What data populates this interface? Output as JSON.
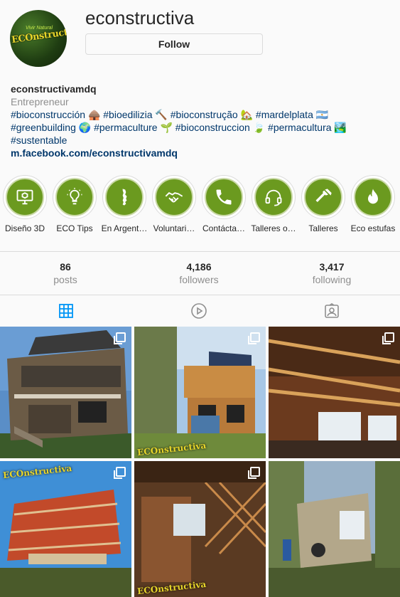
{
  "profile": {
    "username": "econstructiva",
    "follow_label": "Follow",
    "avatar_text_top": "Vivir Natural",
    "avatar_text": "ECOnstructiva",
    "display_name": "econstructivamdq",
    "category": "Entrepreneur",
    "bio_line1": "#bioconstrucción 🛖 #bioedilizia 🔨 #bioconstrução 🏡 #mardelplata 🇦🇷",
    "bio_line2": "#greenbuilding 🌍 #permaculture 🌱 #bioconstruccion 🍃 #permacultura 🏞️",
    "bio_line3": "#sustentable",
    "website": "m.facebook.com/econstructivamdq"
  },
  "highlights": [
    {
      "label": "Diseño 3D",
      "icon": "cube-monitor-icon"
    },
    {
      "label": "ECO Tips",
      "icon": "lightbulb-icon"
    },
    {
      "label": "En Argent…",
      "icon": "argentina-map-icon"
    },
    {
      "label": "Voluntari…",
      "icon": "handshake-icon"
    },
    {
      "label": "Contácta…",
      "icon": "phone-icon"
    },
    {
      "label": "Talleres o…",
      "icon": "headset-icon"
    },
    {
      "label": "Talleres",
      "icon": "hammer-icon"
    },
    {
      "label": "Eco estufas",
      "icon": "flame-icon"
    }
  ],
  "stats": {
    "posts_num": "86",
    "posts_label": "posts",
    "followers_num": "4,186",
    "followers_label": "followers",
    "following_num": "3,417",
    "following_label": "following"
  },
  "tabs": [
    {
      "name": "posts",
      "icon": "grid-icon",
      "active": true
    },
    {
      "name": "igtv",
      "icon": "play-circle-icon",
      "active": false
    },
    {
      "name": "tagged",
      "icon": "tagged-icon",
      "active": false
    }
  ],
  "colors": {
    "accent_blue": "#0095f6",
    "link": "#00376b",
    "highlight_green": "#6b9a1f",
    "muted": "#8e8e8e"
  },
  "posts": [
    {
      "watermark": ""
    },
    {
      "watermark": "ECOnstructiva"
    },
    {
      "watermark": ""
    },
    {
      "watermark": "ECOnstructiva"
    },
    {
      "watermark": "ECOnstructiva"
    },
    {
      "watermark": ""
    }
  ]
}
